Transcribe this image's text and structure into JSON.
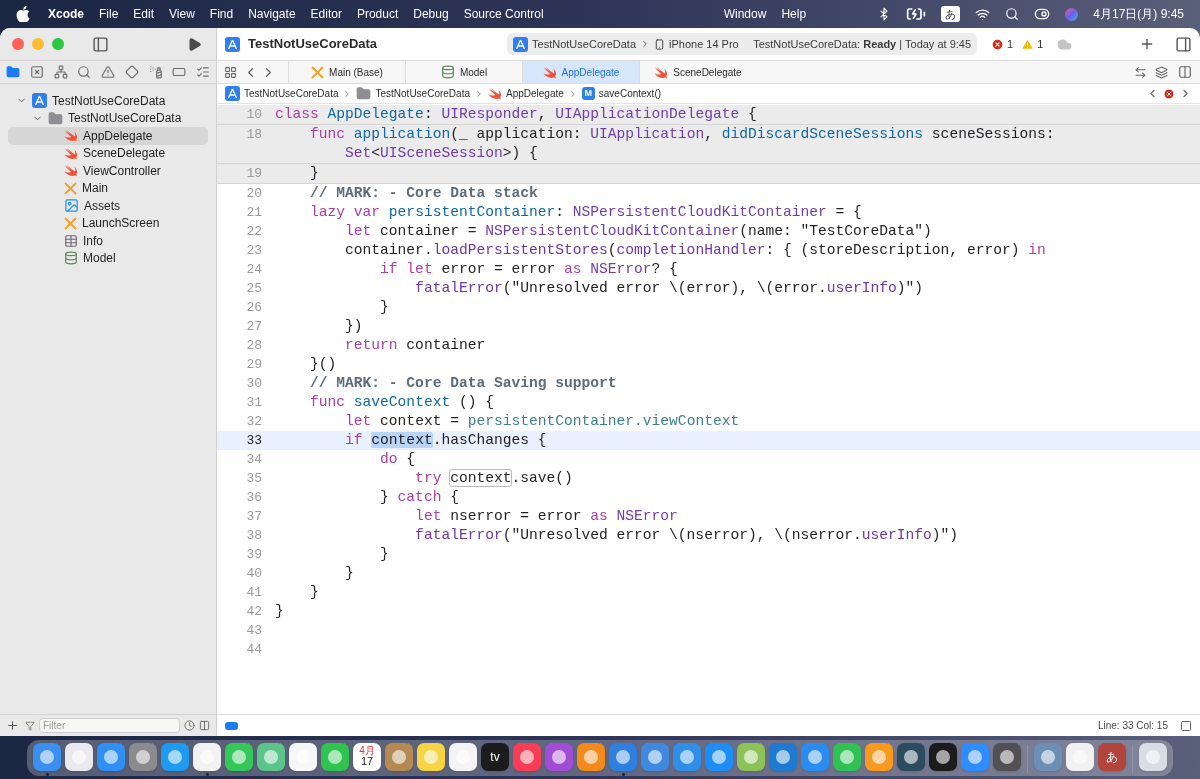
{
  "menu_bar": {
    "menus": [
      {
        "label": "Xcode",
        "kind": "app"
      },
      {
        "label": "File",
        "kind": "menu"
      },
      {
        "label": "Edit",
        "kind": "menu"
      },
      {
        "label": "View",
        "kind": "menu"
      },
      {
        "label": "Find",
        "kind": "menu"
      },
      {
        "label": "Navigate",
        "kind": "menu"
      },
      {
        "label": "Editor",
        "kind": "menu"
      },
      {
        "label": "Product",
        "kind": "menu"
      },
      {
        "label": "Debug",
        "kind": "menu"
      },
      {
        "label": "Source Control",
        "kind": "menu"
      }
    ],
    "menus_after_notch": [
      {
        "label": "Window",
        "kind": "menu"
      },
      {
        "label": "Help",
        "kind": "menu"
      }
    ],
    "input_method": "あ",
    "clock": "4月17日(月) 9:45"
  },
  "toolbar": {
    "project": "TestNotUseCoreData",
    "scheme": "TestNotUseCoreData",
    "device": "iPhone 14 Pro",
    "status": "TestNotUseCoreData: **Ready** | Today at 9:45",
    "errors": "1",
    "warnings": "1"
  },
  "navigator_tabs": [
    {
      "selected": true
    },
    {
      "selected": false
    },
    {
      "selected": false
    },
    {
      "selected": false
    },
    {
      "selected": false
    },
    {
      "selected": false
    },
    {
      "selected": false
    },
    {
      "selected": false
    },
    {
      "selected": false
    }
  ],
  "navigator": [
    {
      "label": "TestNotUseCoreData",
      "kind": "project",
      "expanded": true,
      "selected": false,
      "children": [
        {
          "label": "TestNotUseCoreData",
          "kind": "folder",
          "expanded": true,
          "selected": false,
          "children": [
            {
              "label": "AppDelegate",
              "kind": "swift",
              "selected": true
            },
            {
              "label": "SceneDelegate",
              "kind": "swift",
              "selected": false
            },
            {
              "label": "ViewController",
              "kind": "swift",
              "selected": false
            },
            {
              "label": "Main",
              "kind": "storyboard",
              "selected": false
            },
            {
              "label": "Assets",
              "kind": "assets",
              "selected": false
            },
            {
              "label": "LaunchScreen",
              "kind": "storyboard",
              "selected": false
            },
            {
              "label": "Info",
              "kind": "plist",
              "selected": false
            },
            {
              "label": "Model",
              "kind": "model",
              "selected": false
            }
          ]
        }
      ]
    }
  ],
  "filter": {
    "placeholder": "Filter"
  },
  "tabs": [
    {
      "label": "Main (Base)",
      "kind": "storyboard",
      "selected": false
    },
    {
      "label": "Model",
      "kind": "model",
      "selected": false
    },
    {
      "label": "AppDelegate",
      "kind": "swift",
      "selected": true
    },
    {
      "label": "SceneDelegate",
      "kind": "swift",
      "selected": false
    }
  ],
  "breadcrumb": [
    {
      "label": "TestNotUseCoreData",
      "kind": "project"
    },
    {
      "label": "TestNotUseCoreData",
      "kind": "folder"
    },
    {
      "label": "AppDelegate",
      "kind": "swift"
    },
    {
      "label": "saveContext()",
      "kind": "method",
      "badge": "M"
    }
  ],
  "code": [
    {
      "number": "10",
      "sticky": true,
      "current": false,
      "tokens": [
        {
          "text": "class ",
          "kind": "kw"
        },
        {
          "text": "AppDelegate",
          "kind": "decl"
        },
        {
          "text": ": ",
          "kind": "plain"
        },
        {
          "text": "UIResponder",
          "kind": "type"
        },
        {
          "text": ", ",
          "kind": "plain"
        },
        {
          "text": "UIApplicationDelegate",
          "kind": "type"
        },
        {
          "text": " {",
          "kind": "plain"
        }
      ]
    },
    {
      "number": "18",
      "sticky": true,
      "current": false,
      "tokens": [
        {
          "text": "    func ",
          "kind": "kw"
        },
        {
          "text": "application",
          "kind": "decl"
        },
        {
          "text": "(_ application: ",
          "kind": "plain"
        },
        {
          "text": "UIApplication",
          "kind": "type"
        },
        {
          "text": ", ",
          "kind": "plain"
        },
        {
          "text": "didDiscardSceneSessions",
          "kind": "decl"
        },
        {
          "text": " sceneSessions:",
          "kind": "plain"
        }
      ],
      "wrap": [
        {
          "text": "        Set",
          "kind": "type"
        },
        {
          "text": "<",
          "kind": "plain"
        },
        {
          "text": "UISceneSession",
          "kind": "type"
        },
        {
          "text": ">) {",
          "kind": "plain"
        }
      ]
    },
    {
      "number": "19",
      "sticky": true,
      "current": false,
      "tokens": [
        {
          "text": "    }",
          "kind": "plain"
        }
      ]
    },
    {
      "number": "20",
      "sticky": false,
      "current": false,
      "tokens": [
        {
          "text": "    // MARK: - Core Data stack",
          "kind": "comment"
        }
      ]
    },
    {
      "number": "21",
      "sticky": false,
      "current": false,
      "tokens": [
        {
          "text": "    lazy var ",
          "kind": "kw"
        },
        {
          "text": "persistentContainer",
          "kind": "decl"
        },
        {
          "text": ": ",
          "kind": "plain"
        },
        {
          "text": "NSPersistentCloudKitContainer",
          "kind": "type"
        },
        {
          "text": " = {",
          "kind": "plain"
        }
      ]
    },
    {
      "number": "22",
      "sticky": false,
      "current": false,
      "tokens": [
        {
          "text": "        let",
          "kind": "kw"
        },
        {
          "text": " container = ",
          "kind": "plain"
        },
        {
          "text": "NSPersistentCloudKitContainer",
          "kind": "type"
        },
        {
          "text": "(name: \"TestCoreData\")",
          "kind": "plain"
        }
      ]
    },
    {
      "number": "23",
      "sticky": false,
      "current": false,
      "tokens": [
        {
          "text": "        container.",
          "kind": "plain"
        },
        {
          "text": "loadPersistentStores",
          "kind": "call"
        },
        {
          "text": "(",
          "kind": "plain"
        },
        {
          "text": "completionHandler",
          "kind": "call"
        },
        {
          "text": ": { (storeDescription, error) ",
          "kind": "plain"
        },
        {
          "text": "in",
          "kind": "kw"
        }
      ]
    },
    {
      "number": "24",
      "sticky": false,
      "current": false,
      "tokens": [
        {
          "text": "            if let",
          "kind": "kw"
        },
        {
          "text": " error = error ",
          "kind": "plain"
        },
        {
          "text": "as ",
          "kind": "kw"
        },
        {
          "text": "NSError",
          "kind": "type"
        },
        {
          "text": "? {",
          "kind": "plain"
        }
      ]
    },
    {
      "number": "25",
      "sticky": false,
      "current": false,
      "tokens": [
        {
          "text": "                fatalError",
          "kind": "call"
        },
        {
          "text": "(\"Unresolved error \\(error), \\(error.",
          "kind": "plain"
        },
        {
          "text": "userInfo",
          "kind": "call"
        },
        {
          "text": ")\")",
          "kind": "plain"
        }
      ]
    },
    {
      "number": "26",
      "sticky": false,
      "current": false,
      "tokens": [
        {
          "text": "            }",
          "kind": "plain"
        }
      ]
    },
    {
      "number": "27",
      "sticky": false,
      "current": false,
      "tokens": [
        {
          "text": "        })",
          "kind": "plain"
        }
      ]
    },
    {
      "number": "28",
      "sticky": false,
      "current": false,
      "tokens": [
        {
          "text": "        return",
          "kind": "kw"
        },
        {
          "text": " container",
          "kind": "plain"
        }
      ]
    },
    {
      "number": "29",
      "sticky": false,
      "current": false,
      "tokens": [
        {
          "text": "    }()",
          "kind": "plain"
        }
      ]
    },
    {
      "number": "30",
      "sticky": false,
      "current": false,
      "tokens": [
        {
          "text": "    // MARK: - Core Data Saving support",
          "kind": "comment"
        }
      ]
    },
    {
      "number": "31",
      "sticky": false,
      "current": false,
      "tokens": [
        {
          "text": "    func ",
          "kind": "kw"
        },
        {
          "text": "saveContext",
          "kind": "decl"
        },
        {
          "text": " () {",
          "kind": "plain"
        }
      ]
    },
    {
      "number": "32",
      "sticky": false,
      "current": false,
      "tokens": [
        {
          "text": "        let",
          "kind": "kw"
        },
        {
          "text": " context = ",
          "kind": "plain"
        },
        {
          "text": "persistentContainer.viewContext",
          "kind": "member"
        }
      ]
    },
    {
      "number": "33",
      "sticky": false,
      "current": true,
      "tokens": [
        {
          "text": "        if ",
          "kind": "kw"
        },
        {
          "text": "context",
          "kind": "plain",
          "selected": true,
          "marked": false
        },
        {
          "text": ".hasChanges {",
          "kind": "plain"
        }
      ]
    },
    {
      "number": "34",
      "sticky": false,
      "current": false,
      "tokens": [
        {
          "text": "            do",
          "kind": "kw"
        },
        {
          "text": " {",
          "kind": "plain"
        }
      ]
    },
    {
      "number": "35",
      "sticky": false,
      "current": false,
      "tokens": [
        {
          "text": "                try ",
          "kind": "kw"
        },
        {
          "text": "context",
          "kind": "plain",
          "selected": false,
          "marked": true
        },
        {
          "text": ".save()",
          "kind": "plain"
        }
      ]
    },
    {
      "number": "36",
      "sticky": false,
      "current": false,
      "tokens": [
        {
          "text": "            } ",
          "kind": "plain"
        },
        {
          "text": "catch",
          "kind": "kw"
        },
        {
          "text": " {",
          "kind": "plain"
        }
      ]
    },
    {
      "number": "37",
      "sticky": false,
      "current": false,
      "tokens": [
        {
          "text": "                let",
          "kind": "kw"
        },
        {
          "text": " nserror = error ",
          "kind": "plain"
        },
        {
          "text": "as ",
          "kind": "kw"
        },
        {
          "text": "NSError",
          "kind": "type"
        }
      ]
    },
    {
      "number": "38",
      "sticky": false,
      "current": false,
      "tokens": [
        {
          "text": "                fatalError",
          "kind": "call"
        },
        {
          "text": "(\"Unresolved error \\(nserror), \\(nserror.",
          "kind": "plain"
        },
        {
          "text": "userInfo",
          "kind": "call"
        },
        {
          "text": ")\")",
          "kind": "plain"
        }
      ]
    },
    {
      "number": "39",
      "sticky": false,
      "current": false,
      "tokens": [
        {
          "text": "            }",
          "kind": "plain"
        }
      ]
    },
    {
      "number": "40",
      "sticky": false,
      "current": false,
      "tokens": [
        {
          "text": "        }",
          "kind": "plain"
        }
      ]
    },
    {
      "number": "41",
      "sticky": false,
      "current": false,
      "tokens": [
        {
          "text": "    }",
          "kind": "plain"
        }
      ]
    },
    {
      "number": "42",
      "sticky": false,
      "current": false,
      "tokens": [
        {
          "text": "}",
          "kind": "plain"
        }
      ]
    },
    {
      "number": "43",
      "sticky": false,
      "current": false
    },
    {
      "number": "44",
      "sticky": false,
      "current": false
    }
  ],
  "status_bar": {
    "position": "Line: 33 Col: 15"
  },
  "dock": [
    {
      "kind": "app",
      "color": "#3b8ff0",
      "running": true
    },
    {
      "kind": "app",
      "color": "#e9e9ef",
      "running": false
    },
    {
      "kind": "app",
      "color": "#2f8ff5",
      "running": false
    },
    {
      "kind": "app",
      "color": "#8a8a8f",
      "running": false
    },
    {
      "kind": "app",
      "color": "#1e9bf0",
      "running": false
    },
    {
      "kind": "app",
      "color": "#f2f2f2",
      "running": true
    },
    {
      "kind": "app",
      "color": "#34c759",
      "running": false
    },
    {
      "kind": "app",
      "color": "#5ac48a",
      "running": false
    },
    {
      "kind": "app",
      "color": "#f7f7f7",
      "running": false
    },
    {
      "kind": "app",
      "color": "#2ec44f",
      "running": false
    },
    {
      "kind": "calendar",
      "color": "#ffffff",
      "running": false,
      "month": "4月",
      "day": "17"
    },
    {
      "kind": "app",
      "color": "#b58a52",
      "running": false
    },
    {
      "kind": "app",
      "color": "#f6d443",
      "running": false
    },
    {
      "kind": "app",
      "color": "#f4f4f4",
      "running": false
    },
    {
      "kind": "label",
      "color": "#1c1c1e",
      "running": false,
      "label": "tv"
    },
    {
      "kind": "app",
      "color": "#fa3c55",
      "running": false
    },
    {
      "kind": "app",
      "color": "#a24bd6",
      "running": false
    },
    {
      "kind": "app",
      "color": "#f38b1c",
      "running": false
    },
    {
      "kind": "app",
      "color": "#2d7fe0",
      "running": true
    },
    {
      "kind": "app",
      "color": "#3f8ae0",
      "running": false
    },
    {
      "kind": "app",
      "color": "#2f8fe8",
      "running": false
    },
    {
      "kind": "app",
      "color": "#1c8ef5",
      "running": false
    },
    {
      "kind": "app",
      "color": "#8cc258",
      "running": false
    },
    {
      "kind": "app",
      "color": "#1f7ad1",
      "running": false
    },
    {
      "kind": "app",
      "color": "#2a8cf0",
      "running": false
    },
    {
      "kind": "app",
      "color": "#2fc154",
      "running": false
    },
    {
      "kind": "app",
      "color": "#f79a1e",
      "running": false
    },
    {
      "kind": "app",
      "color": "#2c4b5e",
      "running": false
    },
    {
      "kind": "app",
      "color": "#1c1c1e",
      "running": false
    },
    {
      "kind": "app",
      "color": "#2d8cff",
      "running": false
    },
    {
      "kind": "app",
      "color": "#505055",
      "running": false
    },
    {
      "kind": "separator"
    },
    {
      "kind": "app",
      "color": "#6e8fb5",
      "running": false
    },
    {
      "kind": "app",
      "color": "#f1f1f1",
      "running": false
    },
    {
      "kind": "label",
      "color": "#b2433d",
      "running": false,
      "label": "あ"
    },
    {
      "kind": "separator"
    },
    {
      "kind": "app",
      "color": "#d8dde3",
      "running": false
    }
  ]
}
